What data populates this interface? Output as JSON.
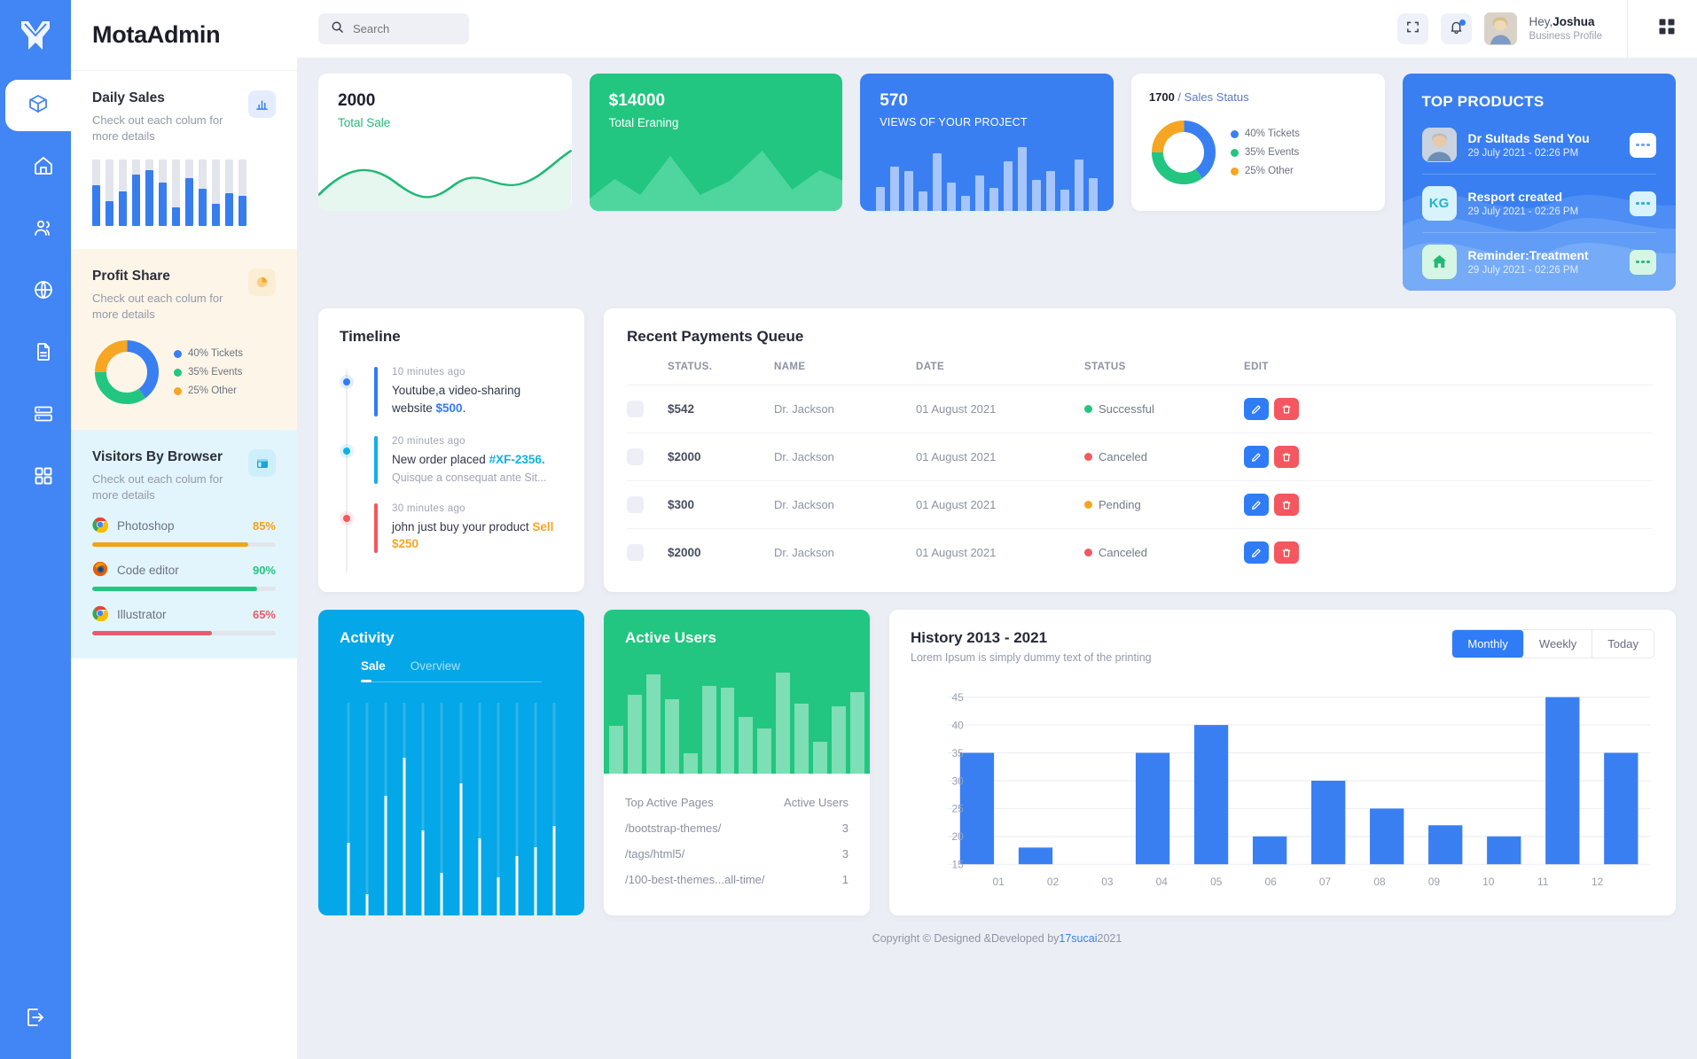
{
  "brand": {
    "title": "MotaAdmin",
    "logo_icon": "mota-logo-icon"
  },
  "rail": {
    "items": [
      {
        "icon": "box-icon",
        "name": "box"
      },
      {
        "icon": "home-icon",
        "name": "home"
      },
      {
        "icon": "users-icon",
        "name": "users"
      },
      {
        "icon": "globe-icon",
        "name": "globe"
      },
      {
        "icon": "file-icon",
        "name": "file"
      },
      {
        "icon": "server-icon",
        "name": "server"
      },
      {
        "icon": "grid-icon",
        "name": "grid"
      }
    ],
    "logout_icon": "logout-icon"
  },
  "topbar": {
    "search_placeholder": "Search",
    "search_value": "",
    "search_icon": "search-icon",
    "fullscreen_icon": "fullscreen-icon",
    "bell_icon": "bell-icon",
    "apps_icon": "apps-grid-icon",
    "greeting_prefix": "Hey,",
    "user_name": "Joshua",
    "user_role": "Business Profile"
  },
  "sidebar_cards": {
    "daily_sales": {
      "title": "Daily Sales",
      "subtitle": "Check out each colum for more details",
      "badge_icon": "bar-chart-icon",
      "bars": [
        62,
        38,
        52,
        78,
        84,
        66,
        28,
        72,
        56,
        34,
        50,
        46
      ]
    },
    "profit_share": {
      "title": "Profit Share",
      "subtitle": "Check out each colum for more details",
      "badge_icon": "pie-chart-icon",
      "legend": [
        {
          "label": "40% Tickets",
          "color": "#3a7ff2"
        },
        {
          "label": "35% Events",
          "color": "#22c680"
        },
        {
          "label": "25% Other",
          "color": "#f6a623"
        }
      ]
    },
    "visitors_by_browser": {
      "title": "Visitors By Browser",
      "subtitle": "Check out each colum for more details",
      "badge_icon": "browser-window-icon",
      "rows": [
        {
          "name": "Photoshop",
          "pct": "85%",
          "value": 85,
          "color": "#f1a31a",
          "icon": "chrome-icon"
        },
        {
          "name": "Code editor",
          "pct": "90%",
          "value": 90,
          "color": "#22c680",
          "icon": "firefox-icon"
        },
        {
          "name": "Illustrator",
          "pct": "65%",
          "value": 65,
          "color": "#ec5b6b",
          "icon": "chrome-icon"
        }
      ]
    }
  },
  "stats": {
    "total_sale": {
      "value": "2000",
      "label": "Total Sale"
    },
    "total_earning": {
      "value": "$14000",
      "label": "Total Eraning"
    },
    "views": {
      "value": "570",
      "label": "VIEWS OF YOUR PROJECT",
      "bars": [
        38,
        70,
        62,
        30,
        90,
        44,
        24,
        56,
        36,
        78,
        100,
        48,
        62,
        34,
        80,
        52
      ]
    },
    "sales_status": {
      "number": "1700",
      "separator": " / ",
      "label": "Sales Status",
      "legend": [
        {
          "label": "40% Tickets",
          "color": "#3a7ff2"
        },
        {
          "label": "35% Events",
          "color": "#22c680"
        },
        {
          "label": "25% Other",
          "color": "#f6a623"
        }
      ]
    }
  },
  "top_products": {
    "title": "TOP PRODUCTS",
    "items": [
      {
        "name": "Dr Sultads Send You",
        "date": "29 July 2021 - 02:26 PM",
        "avatar_type": "photo",
        "initials": "",
        "more_icon": "more-dots-icon"
      },
      {
        "name": "Resport created",
        "date": "29 July 2021 - 02:26 PM",
        "avatar_type": "initials",
        "initials": "KG",
        "more_icon": "more-dots-icon"
      },
      {
        "name": "Reminder:Treatment",
        "date": "29 July 2021 - 02:26 PM",
        "avatar_type": "icon",
        "initials": "",
        "icon": "home-icon",
        "more_icon": "more-dots-icon"
      }
    ]
  },
  "timeline": {
    "title": "Timeline",
    "items": [
      {
        "time": "10 minutes ago",
        "text": "Youtube,a video-sharing website ",
        "highlight": "$500",
        "suffix": ".",
        "sub": "",
        "color": "#2f7cf6",
        "highlight_color": "#2f7cf6"
      },
      {
        "time": "20 minutes ago",
        "text": "New order placed ",
        "highlight": "#XF-2356.",
        "suffix": "",
        "sub": "Quisque a consequat ante Sit...",
        "color": "#11b0e3",
        "highlight_color": "#11b0e3"
      },
      {
        "time": "30 minutes ago",
        "text": "john just buy your product ",
        "highlight": "Sell $250",
        "suffix": "",
        "sub": "",
        "color": "#f4575f",
        "highlight_color": "#f6a623"
      }
    ]
  },
  "payments": {
    "title": "Recent Payments Queue",
    "columns": [
      "",
      "STATUS.",
      "NAME",
      "DATE",
      "STATUS",
      "EDIT"
    ],
    "rows": [
      {
        "amount": "$542",
        "name": "Dr. Jackson",
        "date": "01 August 2021",
        "status": "Successful",
        "status_color": "#22c680"
      },
      {
        "amount": "$2000",
        "name": "Dr. Jackson",
        "date": "01 August 2021",
        "status": "Canceled",
        "status_color": "#f4575f"
      },
      {
        "amount": "$300",
        "name": "Dr. Jackson",
        "date": "01 August 2021",
        "status": "Pending",
        "status_color": "#f6a623"
      },
      {
        "amount": "$2000",
        "name": "Dr. Jackson",
        "date": "01 August 2021",
        "status": "Canceled",
        "status_color": "#f4575f"
      }
    ],
    "edit_icon": "pencil-icon",
    "delete_icon": "trash-icon"
  },
  "activity": {
    "title": "Activity",
    "tabs": [
      {
        "label": "Sale",
        "active": true
      },
      {
        "label": "Overview",
        "active": false
      }
    ],
    "bars": [
      34,
      10,
      56,
      74,
      40,
      20,
      62,
      36,
      18,
      28,
      32,
      42
    ]
  },
  "active_users": {
    "title": "Active Users",
    "bars": [
      42,
      70,
      88,
      66,
      18,
      78,
      76,
      50,
      40,
      90,
      62,
      28,
      60,
      72
    ],
    "table_headers": [
      "Top Active Pages",
      "Active Users"
    ],
    "rows": [
      {
        "page": "/bootstrap-themes/",
        "users": "3"
      },
      {
        "page": "/tags/html5/",
        "users": "3"
      },
      {
        "page": "/100-best-themes...all-time/",
        "users": "1"
      }
    ]
  },
  "history": {
    "title": "History 2013 - 2021",
    "subtitle": "Lorem Ipsum is simply dummy text of the printing",
    "segments": [
      {
        "label": "Monthly",
        "active": true
      },
      {
        "label": "Weekly",
        "active": false
      },
      {
        "label": "Today",
        "active": false
      }
    ]
  },
  "chart_data": {
    "type": "bar",
    "title": "History 2013 - 2021",
    "subtitle": "Lorem Ipsum is simply dummy text of the printing",
    "categories": [
      "01",
      "02",
      "03",
      "04",
      "05",
      "06",
      "07",
      "08",
      "09",
      "10",
      "11",
      "12"
    ],
    "values": [
      35,
      18,
      15,
      35,
      40,
      20,
      30,
      25,
      22,
      20,
      45,
      35
    ],
    "yticks": [
      15,
      20,
      25,
      30,
      35,
      40,
      45
    ],
    "ylim": [
      15,
      45
    ],
    "xlabel": "",
    "ylabel": "",
    "grid": true,
    "legend": "none",
    "bar_color": "#3a7ff2"
  },
  "footer": {
    "text_before": "Copyright © Designed &Developed by ",
    "link": "17sucai",
    "text_after": "2021"
  }
}
